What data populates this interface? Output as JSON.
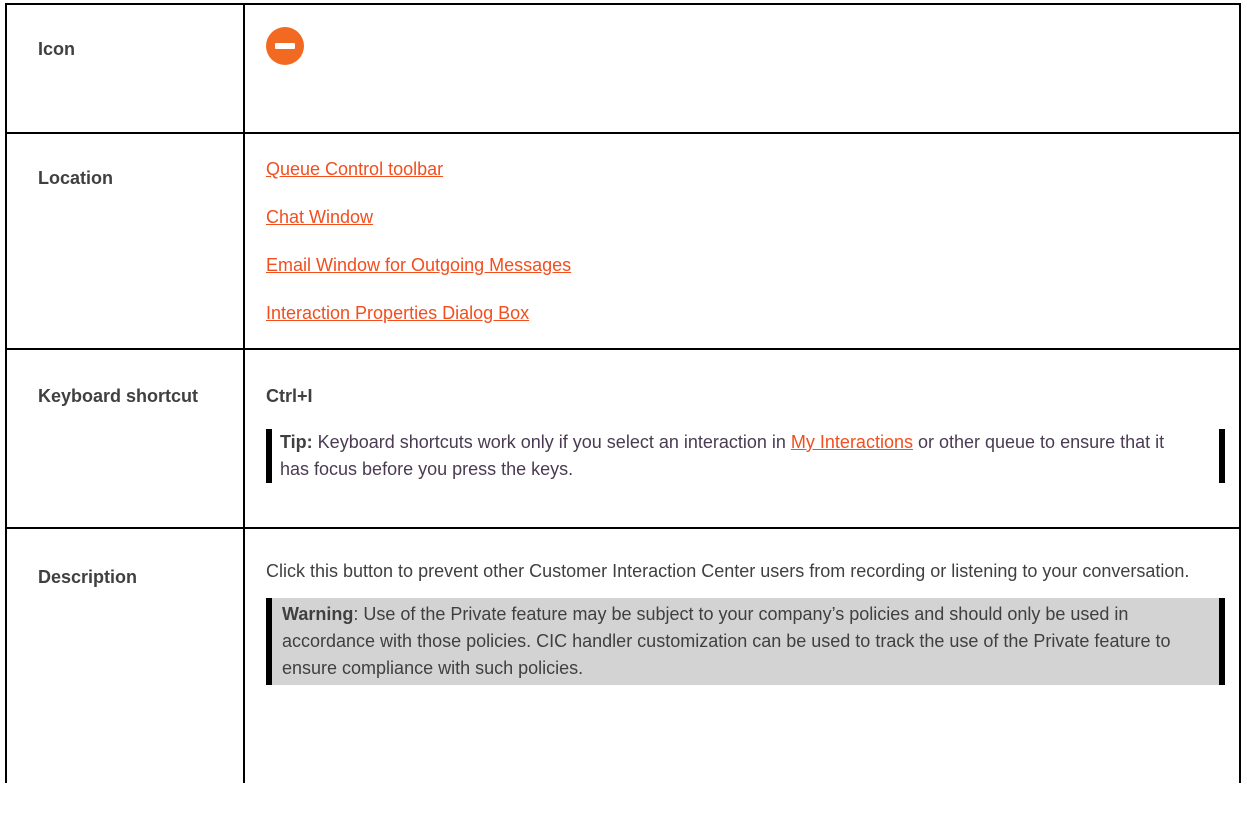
{
  "rows": {
    "icon": {
      "label": "Icon",
      "icon_name": "stop-minus-icon",
      "icon_color": "#f26a21"
    },
    "location": {
      "label": "Location",
      "links": [
        "Queue Control toolbar",
        "Chat Window",
        "Email Window for Outgoing Messages",
        "Interaction Properties Dialog Box"
      ]
    },
    "keyboard": {
      "label": "Keyboard shortcut",
      "shortcut": "Ctrl+I",
      "tip_prefix": "Tip:",
      "tip_text_before": " Keyboard shortcuts work only if you select an interaction in ",
      "tip_link": "My Interactions",
      "tip_text_after": " or other queue to ensure that it has focus before you press the keys."
    },
    "description": {
      "label": "Description",
      "text": "Click this button to prevent other Customer Interaction Center users from recording or listening to your conversation.",
      "warning_prefix": "Warning",
      "warning_text": ": Use of the Private feature may be subject to your company’s policies and should only be used in accordance with those policies. CIC handler customization can be used to track the use of the Private feature to ensure compliance with such policies."
    }
  },
  "colors": {
    "link": "#f24e1e",
    "text": "#404040",
    "warning_bg": "#d3d3d3"
  }
}
